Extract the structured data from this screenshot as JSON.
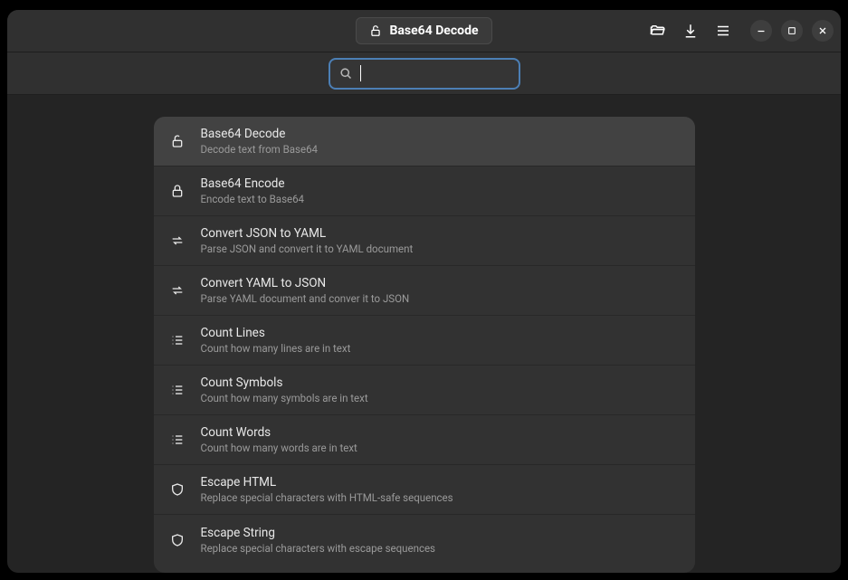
{
  "titlebar": {
    "title": "Base64 Decode"
  },
  "search": {
    "value": "",
    "placeholder": ""
  },
  "tools": [
    {
      "title": "Base64 Decode",
      "desc": "Decode text from Base64",
      "icon": "unlock",
      "selected": true
    },
    {
      "title": "Base64 Encode",
      "desc": "Encode text to Base64",
      "icon": "lock",
      "selected": false
    },
    {
      "title": "Convert JSON to YAML",
      "desc": "Parse JSON and convert it to YAML document",
      "icon": "swap",
      "selected": false
    },
    {
      "title": "Convert YAML to JSON",
      "desc": "Parse YAML document and conver it to JSON",
      "icon": "swap",
      "selected": false
    },
    {
      "title": "Count Lines",
      "desc": "Count how many lines are in text",
      "icon": "list",
      "selected": false
    },
    {
      "title": "Count Symbols",
      "desc": "Count how many symbols are in text",
      "icon": "list",
      "selected": false
    },
    {
      "title": "Count Words",
      "desc": "Count how many words are in text",
      "icon": "list",
      "selected": false
    },
    {
      "title": "Escape HTML",
      "desc": "Replace special characters with HTML-safe sequences",
      "icon": "shield",
      "selected": false
    },
    {
      "title": "Escape String",
      "desc": "Replace special characters with escape sequences",
      "icon": "shield",
      "selected": false
    }
  ]
}
